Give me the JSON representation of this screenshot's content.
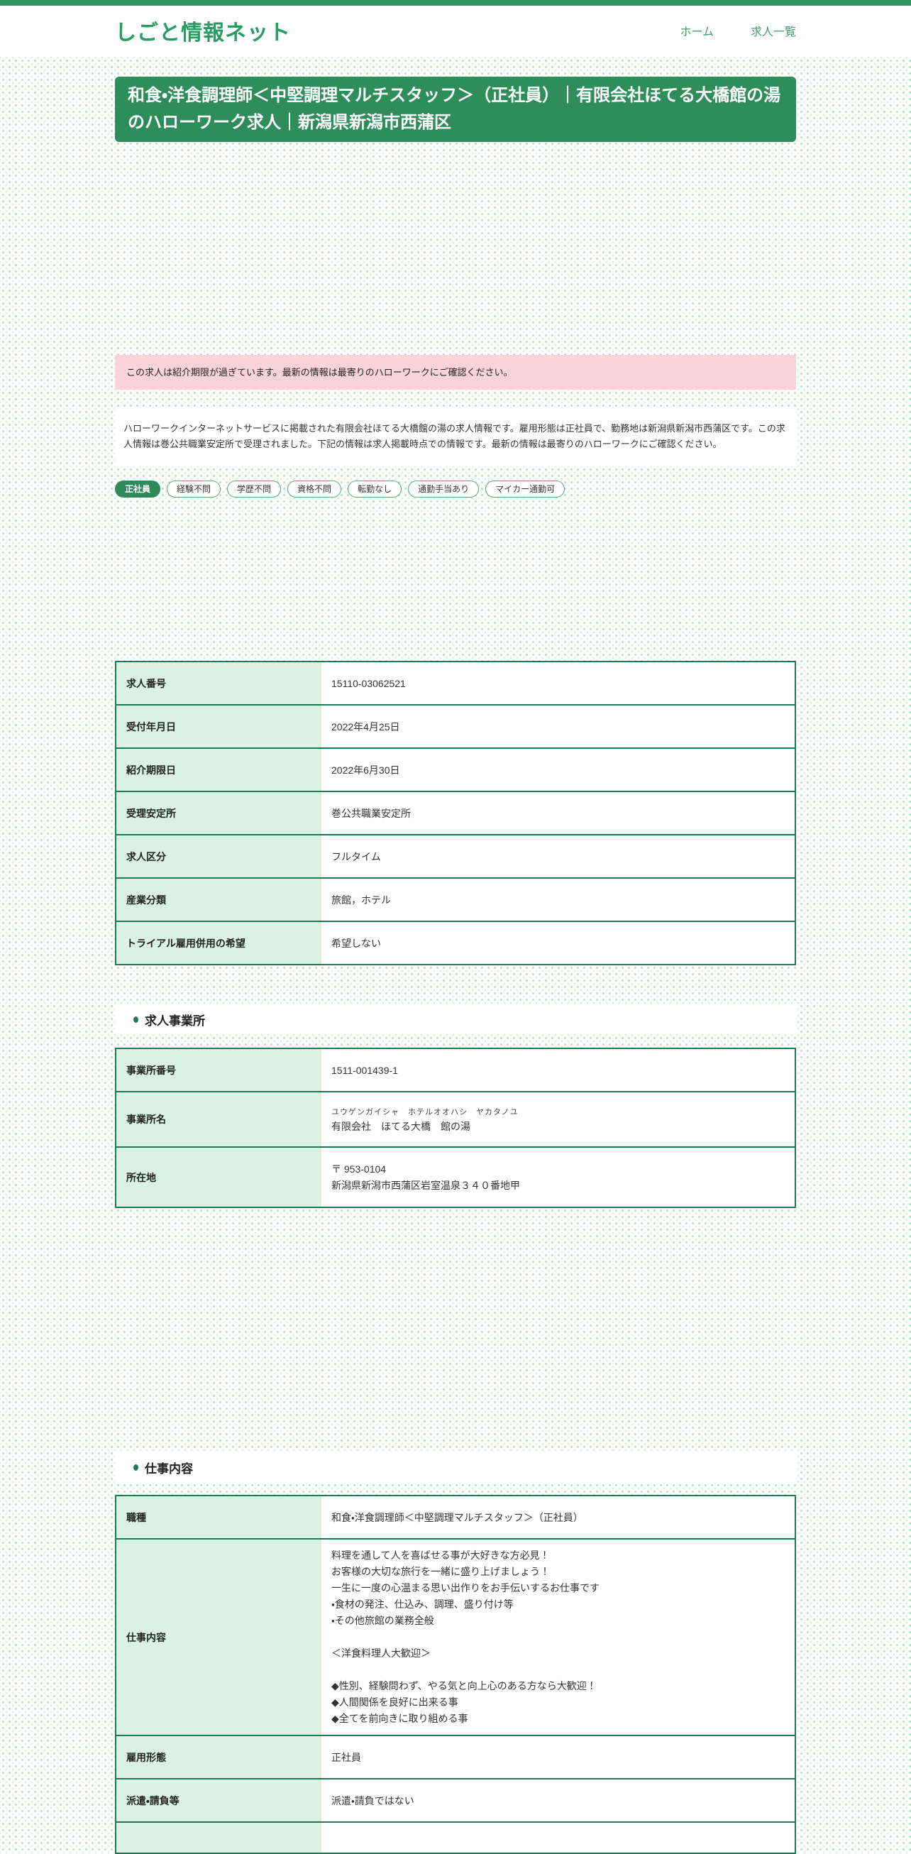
{
  "colors": {
    "accent_green": "#2e8b57",
    "banner_green": "#2f8c5b",
    "table_border_green": "#1e7a54",
    "label_cell_green": "#d9f2e3",
    "notice_pink": "#f9d2da"
  },
  "header": {
    "logo": "しごと情報ネット",
    "nav": [
      {
        "label": "ホーム"
      },
      {
        "label": "求人一覧"
      }
    ]
  },
  "title_banner": {
    "text": "和食・洋食調理師＜中堅調理マルチスタッフ＞（正社員）｜有限会社ほてる大橋館の湯のハローワーク求人｜新潟県新潟市西蒲区"
  },
  "notice": {
    "text": "この求人は紹介期限が過ぎています。最新の情報は最寄りのハローワークにご確認ください。"
  },
  "intro": {
    "text": "ハローワークインターネットサービスに掲載された有限会社ほてる大橋館の湯の求人情報です。雇用形態は正社員で、勤務地は新潟県新潟市西蒲区です。この求人情報は巻公共職業安定所で受理されました。下記の情報は求人掲載時点での情報です。最新の情報は最寄りのハローワークにご確認ください。"
  },
  "badges": [
    {
      "label": "正社員",
      "filled": true
    },
    {
      "label": "経験不問",
      "filled": false
    },
    {
      "label": "学歴不問",
      "filled": false
    },
    {
      "label": "資格不問",
      "filled": false
    },
    {
      "label": "転勤なし",
      "filled": false
    },
    {
      "label": "通勤手当あり",
      "filled": false
    },
    {
      "label": "マイカー通勤可",
      "filled": false
    }
  ],
  "summary_table": {
    "rows": [
      {
        "label": "求人番号",
        "value": "15110-03062521"
      },
      {
        "label": "受付年月日",
        "value": "2022年4月25日"
      },
      {
        "label": "紹介期限日",
        "value": "2022年6月30日"
      },
      {
        "label": "受理安定所",
        "value": "巻公共職業安定所"
      },
      {
        "label": "求人区分",
        "value": "フルタイム"
      },
      {
        "label": "産業分類",
        "value": "旅館，ホテル"
      },
      {
        "label": "トライアル雇用併用の希望",
        "value": "希望しない"
      }
    ]
  },
  "office_section": {
    "title": "求人事業所",
    "rows": [
      {
        "label": "事業所番号",
        "value": "1511-001439-1"
      },
      {
        "label": "事業所名",
        "kana": "ユウゲンガイシャ　ホテルオオハシ　ヤカタノユ",
        "value": "有限会社　ほてる大橋　館の湯"
      },
      {
        "label": "所在地",
        "value": "〒 953-0104\n新潟県新潟市西蒲区岩室温泉３４０番地甲"
      }
    ]
  },
  "job_section": {
    "title": "仕事内容",
    "rows": [
      {
        "label": "職種",
        "value": "和食・洋食調理師＜中堅調理マルチスタッフ＞（正社員）"
      },
      {
        "label": "仕事内容",
        "value": "料理を通して人を喜ばせる事が大好きな方必見！\nお客様の大切な旅行を一緒に盛り上げましょう！\n一生に一度の心温まる思い出作りをお手伝いするお仕事です\n・食材の発注、仕込み、調理、盛り付け等\n・その他旅館の業務全般\n\n＜洋食料理人大歓迎＞\n\n◆性別、経験問わず、やる気と向上心のある方なら大歓迎！\n◆人間関係を良好に出来る事\n◆全てを前向きに取り組める事"
      },
      {
        "label": "雇用形態",
        "value": "正社員"
      },
      {
        "label": "派遣・請負等",
        "value": "派遣・請負ではない"
      }
    ]
  }
}
